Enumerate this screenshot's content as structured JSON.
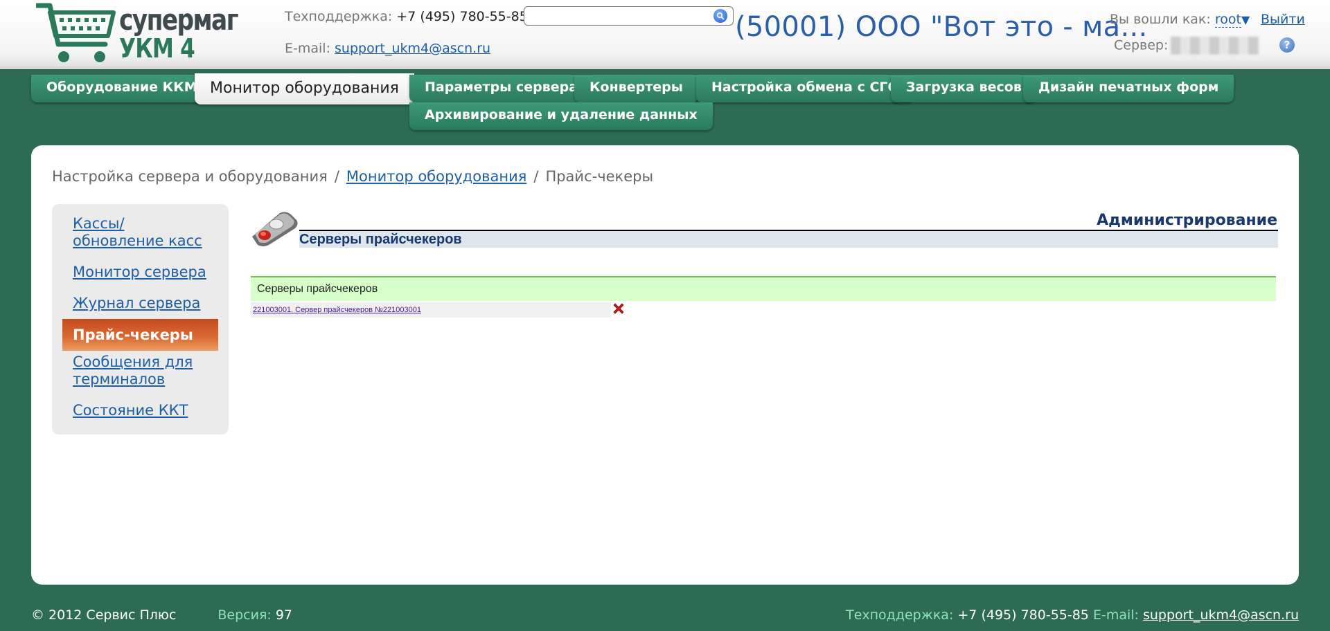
{
  "header": {
    "logo": {
      "line1": "супермаг",
      "line2": "УКМ 4"
    },
    "support_label": "Техподдержка:",
    "support_phone": "+7 (495) 780-55-85",
    "email_label": "E-mail:",
    "email": "support_ukm4@ascn.ru",
    "search": {
      "value": "",
      "placeholder": ""
    },
    "company": "(50001) ООО \"Вот это - ма...",
    "login_label": "Вы вошли как:",
    "user": "root",
    "logout": "Выйти",
    "server_label": "Сервер:",
    "help": "?"
  },
  "tabs": [
    {
      "label": "Оборудование ККМ",
      "active": false
    },
    {
      "label": "Монитор оборудования",
      "active": true
    },
    {
      "label": "Параметры сервера",
      "active": false
    },
    {
      "label": "Конвертеры",
      "active": false
    },
    {
      "label": "Настройка обмена с СГО",
      "active": false
    },
    {
      "label": "Загрузка весов",
      "active": false
    },
    {
      "label": "Дизайн печатных форм",
      "active": false
    },
    {
      "label": "Архивирование и удаление данных",
      "active": false
    }
  ],
  "breadcrumb": {
    "root": "Настройка сервера и оборудования",
    "parent": "Монитор оборудования",
    "current": "Прайс-чекеры",
    "separator": "/"
  },
  "sidebar": {
    "items": [
      {
        "label": "Кассы/обновление касс"
      },
      {
        "label": "Монитор сервера"
      },
      {
        "label": "Журнал сервера"
      },
      {
        "label": "Прайс-чекеры",
        "active": true
      },
      {
        "label": "Сообщения для терминалов"
      },
      {
        "label": "Состояние ККТ"
      }
    ]
  },
  "content": {
    "admin_title": "Администрирование",
    "section_title": "Серверы прайсчекеров",
    "list_header": "Серверы прайсчекеров",
    "rows": [
      {
        "label": "221003001. Сервер прайсчекеров №221003001"
      }
    ]
  },
  "footer": {
    "copyright": "© 2012 Сервис Плюс",
    "version_label": "Версия:",
    "version": "97",
    "support_label": "Техподдержка:",
    "support_phone": "+7 (495) 780-55-85",
    "email_label": "E-mail:",
    "email": "support_ukm4@ascn.ru"
  },
  "colors": {
    "background": "#2d6b52",
    "tab": "#2a7a5c",
    "link": "#1d5fa5",
    "sidebar_active": "#d9602a",
    "list_header_bg": "#d6ffc9"
  }
}
